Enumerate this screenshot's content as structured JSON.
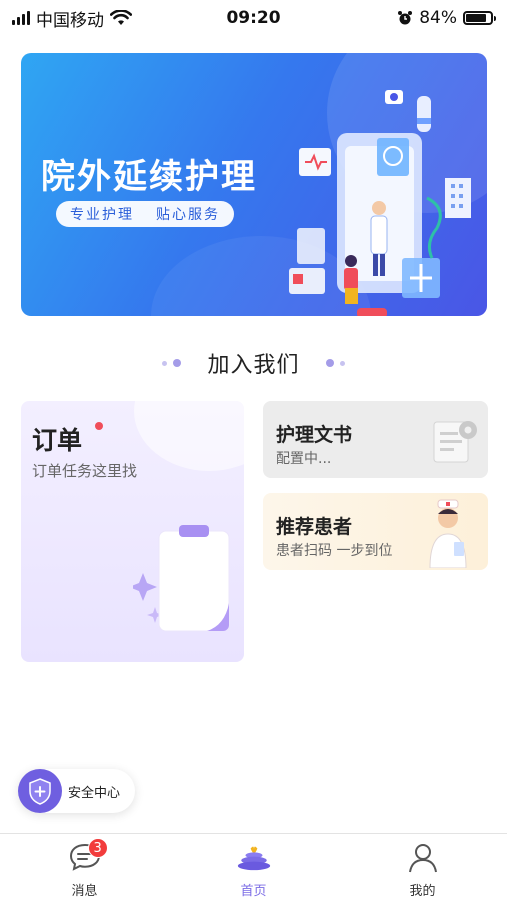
{
  "status_bar": {
    "carrier": "中国移动",
    "time": "09:20",
    "battery": "84%",
    "battery_level": 0.84
  },
  "banner": {
    "title": "院外延续护理",
    "tags": [
      "专业护理",
      "贴心服务"
    ]
  },
  "section": {
    "title": "加入我们"
  },
  "cards": {
    "order": {
      "title": "订单",
      "subtitle": "订单任务这里找"
    },
    "nursing_doc": {
      "title": "护理文书",
      "subtitle": "配置中..."
    },
    "recommend": {
      "title": "推荐患者",
      "subtitle": "患者扫码 一步到位"
    }
  },
  "security": {
    "label": "安全中心"
  },
  "tabbar": {
    "items": [
      {
        "label": "消息",
        "badge": "3",
        "icon": "message-icon"
      },
      {
        "label": "首页",
        "icon": "home-icon",
        "active": true
      },
      {
        "label": "我的",
        "icon": "profile-icon"
      }
    ]
  },
  "colors": {
    "accent": "#7b6ce6",
    "banner_start": "#2fa6f3",
    "banner_end": "#4a56e6",
    "badge": "#f23c3c"
  }
}
